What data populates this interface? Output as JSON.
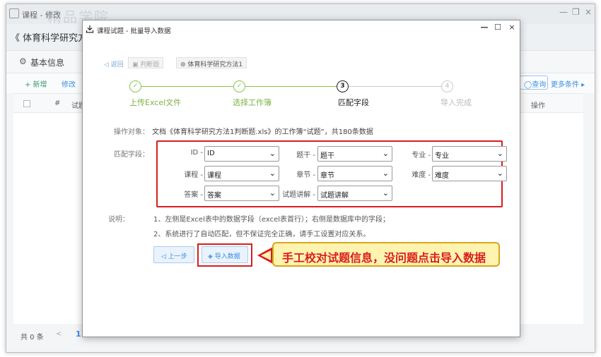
{
  "background": {
    "window_title": "课程 - 修改",
    "watermark": "精品学院",
    "course_title": "《 体育科学研究方法",
    "basic_info_label": "基本信息",
    "toolbar": {
      "add_label": "+ 新增",
      "edit_label": "修改",
      "search_label": "查询",
      "more_label": "更多条件 ▸"
    },
    "table_headers": {
      "index": "#",
      "question": "试题",
      "actions": "操作"
    },
    "footer": {
      "total": "共 0 条",
      "prev": "<",
      "page": "1"
    }
  },
  "dialog": {
    "title": "课程试题 - 批量导入数据",
    "controls": {
      "minimize": "—",
      "maximize": "☐",
      "close": "×"
    },
    "back_label": "返回",
    "chip_type": "判断题",
    "chip_course": "体育科学研究方法1",
    "steps": [
      {
        "num": "✓",
        "label": "上传Excel文件",
        "state": "done"
      },
      {
        "num": "✓",
        "label": "选择工作簿",
        "state": "done"
      },
      {
        "num": "3",
        "label": "匹配字段",
        "state": "active"
      },
      {
        "num": "4",
        "label": "导入完成",
        "state": "todo"
      }
    ],
    "target_label": "操作对象：",
    "target_text": "文档《体育科学研究方法1判断题.xls》的工作簿“试题”，共180条数据",
    "match_label": "匹配字段：",
    "fields": [
      {
        "label": "ID -",
        "value": "ID"
      },
      {
        "label": "题干 -",
        "value": "题干"
      },
      {
        "label": "专业 -",
        "value": "专业"
      },
      {
        "label": "课程 -",
        "value": "课程"
      },
      {
        "label": "章节 -",
        "value": "章节"
      },
      {
        "label": "难度 -",
        "value": "难度"
      },
      {
        "label": "答案 -",
        "value": "答案"
      },
      {
        "label": "试题讲解 -",
        "value": "试题讲解"
      }
    ],
    "notes_label": "说明：",
    "notes": [
      "1、左侧是Excel表中的数据字段（excel表首行）；右侧是数据库中的字段；",
      "2、系统进行了自动匹配，但不保证完全正确，请手工设置对应关系。"
    ],
    "prev_button": "上一步",
    "import_button": "导入数据"
  },
  "callout": {
    "text": "手工校对试题信息，没问题点击导入数据",
    "colors": {
      "border": "#d81e1e",
      "fill": "#fff3b0",
      "text": "#d81e1e"
    }
  }
}
